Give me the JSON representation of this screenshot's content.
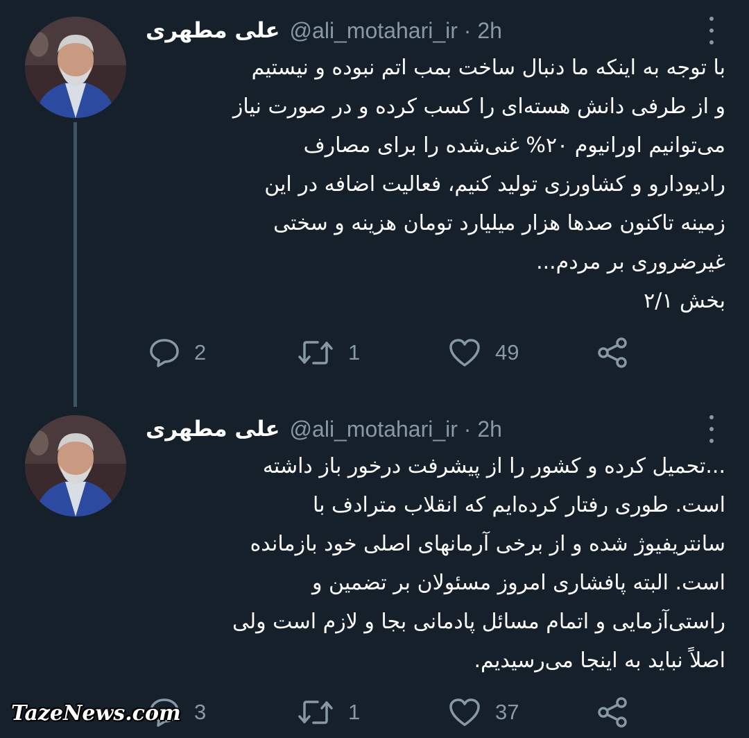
{
  "tweets": [
    {
      "author_name": "علی مطهری",
      "handle": "@ali_motahari_ir",
      "time": "2h",
      "handle_time": "@ali_motahari_ir · 2h",
      "lines": [
        "با توجه به اینکه ما دنبال ساخت بمب اتم نبوده و نیستیم",
        "و از طرفی دانش هسته‌ای را کسب کرده و در صورت نیاز",
        "می‌توانیم اورانیوم ۲۰% غنی‌شده را برای مصارف",
        "رادیودارو و کشاورزی تولید کنیم، فعالیت اضافه در این",
        "زمینه تاکنون صدها هزار میلیارد تومان هزینه و سختی",
        "غیرضروری بر مردم...",
        "بخش ۲/۱"
      ],
      "reply_count": "2",
      "retweet_count": "1",
      "like_count": "49"
    },
    {
      "author_name": "علی مطهری",
      "handle": "@ali_motahari_ir",
      "time": "2h",
      "handle_time": "@ali_motahari_ir · 2h",
      "lines": [
        "...تحمیل کرده و کشور را از پیشرفت درخور باز داشته",
        "است. طوری رفتار کرده‌ایم که انقلاب مترادف با",
        "سانتریفیوژ شده و از برخی آرمانهای اصلی خود بازمانده",
        "است. البته پافشاری امروز مسئولان بر تضمین و",
        "راستی‌آزمایی و اتمام مسائل پادمانی بجا و لازم است ولی",
        "اصلاً نباید به اینجا می‌رسیدیم."
      ],
      "reply_count": "3",
      "retweet_count": "1",
      "like_count": "37"
    }
  ],
  "icons": {
    "reply": "reply-icon",
    "retweet": "retweet-icon",
    "like": "heart-icon",
    "share": "share-icon",
    "more": "more-vertical-icon"
  },
  "colors": {
    "background": "#15202b",
    "muted": "#8899a6",
    "text": "#ffffff",
    "thread_line": "#3d5466"
  },
  "watermark": "TazeNews.com"
}
